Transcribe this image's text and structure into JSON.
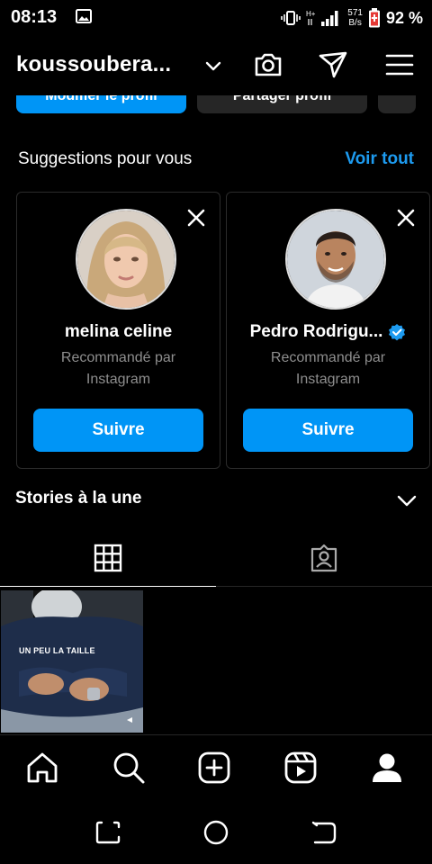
{
  "status_bar": {
    "time": "08:13",
    "net_speed_value": "571",
    "net_speed_unit": "B/s",
    "network_type": "H+",
    "battery": "92 %",
    "icons": [
      "gallery-icon",
      "vibrate-icon",
      "signal-icon",
      "battery-icon"
    ]
  },
  "header": {
    "username": "koussoubera...",
    "icons": [
      "chevron-down-icon",
      "camera-icon",
      "send-icon",
      "menu-icon"
    ]
  },
  "profile_actions": {
    "edit_label": "Modifier le profil",
    "share_label": "Partager profil"
  },
  "suggestions": {
    "title": "Suggestions pour vous",
    "see_all": "Voir tout",
    "cards": [
      {
        "name": "melina celine",
        "verified": false,
        "subtitle_line1": "Recommandé par",
        "subtitle_line2": "Instagram",
        "button": "Suivre"
      },
      {
        "name": "Pedro Rodrigu...",
        "verified": true,
        "subtitle_line1": "Recommandé par",
        "subtitle_line2": "Instagram",
        "button": "Suivre"
      }
    ]
  },
  "highlights": {
    "title": "Stories à la une"
  },
  "tabs": [
    "grid-icon",
    "tagged-icon"
  ],
  "posts": [
    {
      "caption": "UN PEU LA TAILLE"
    }
  ],
  "bottom_nav": [
    "home-icon",
    "search-icon",
    "create-icon",
    "reels-icon",
    "profile-icon"
  ],
  "colors": {
    "accent": "#0095f6",
    "link": "#1d9bf0",
    "background": "#000000",
    "card_border": "#2b2b2b",
    "secondary_text": "#8e8e8e",
    "battery_red": "#e53935"
  }
}
